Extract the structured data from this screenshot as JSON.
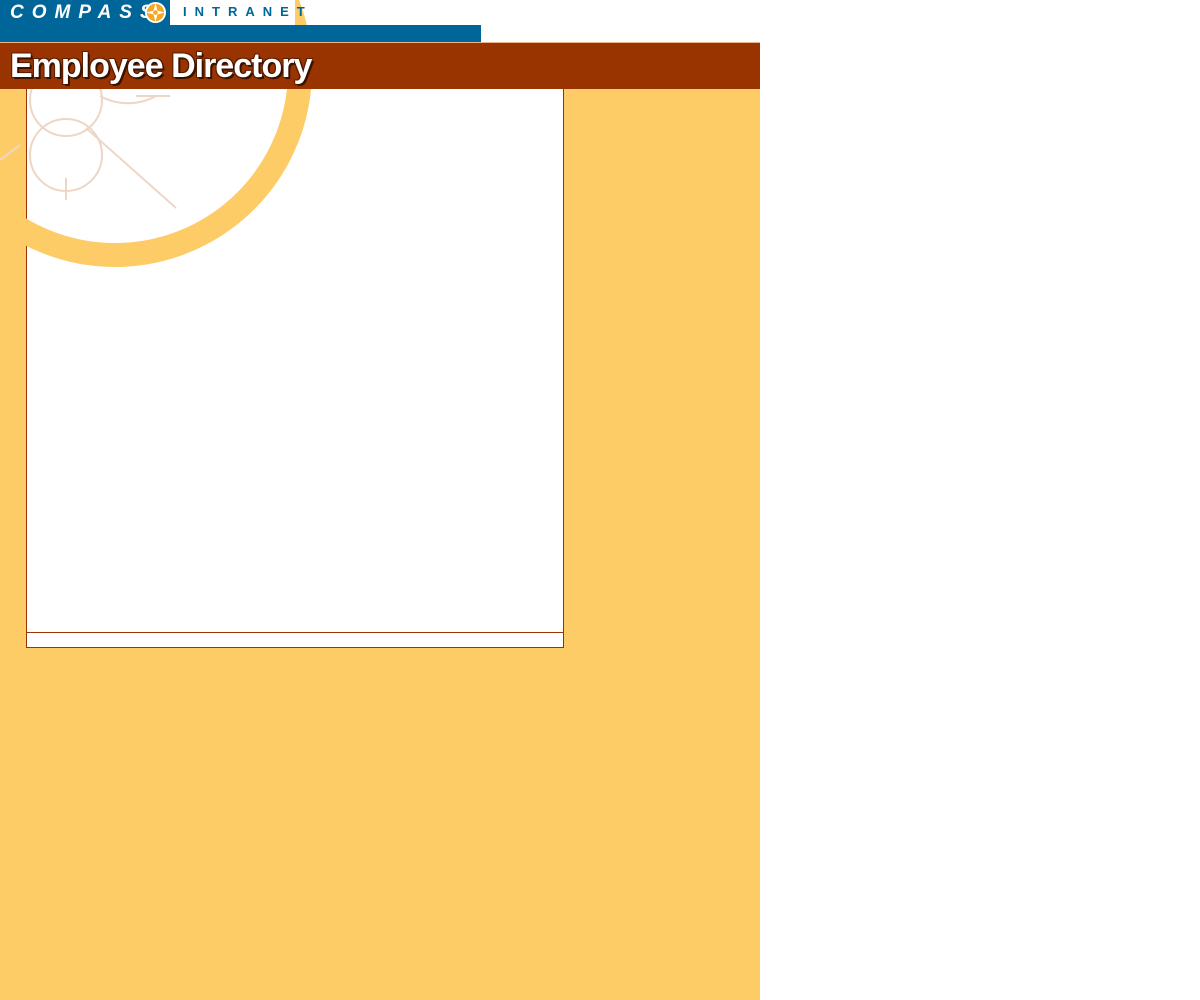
{
  "brand": {
    "name": "COMPASS",
    "tagline": "INTRANET",
    "icon": "compass-rose-icon"
  },
  "page": {
    "title": "Employee Directory"
  },
  "colors": {
    "brand_blue": "#006699",
    "title_bar": "#993300",
    "panel_bg": "#fecc66",
    "frame_border": "#993300"
  }
}
